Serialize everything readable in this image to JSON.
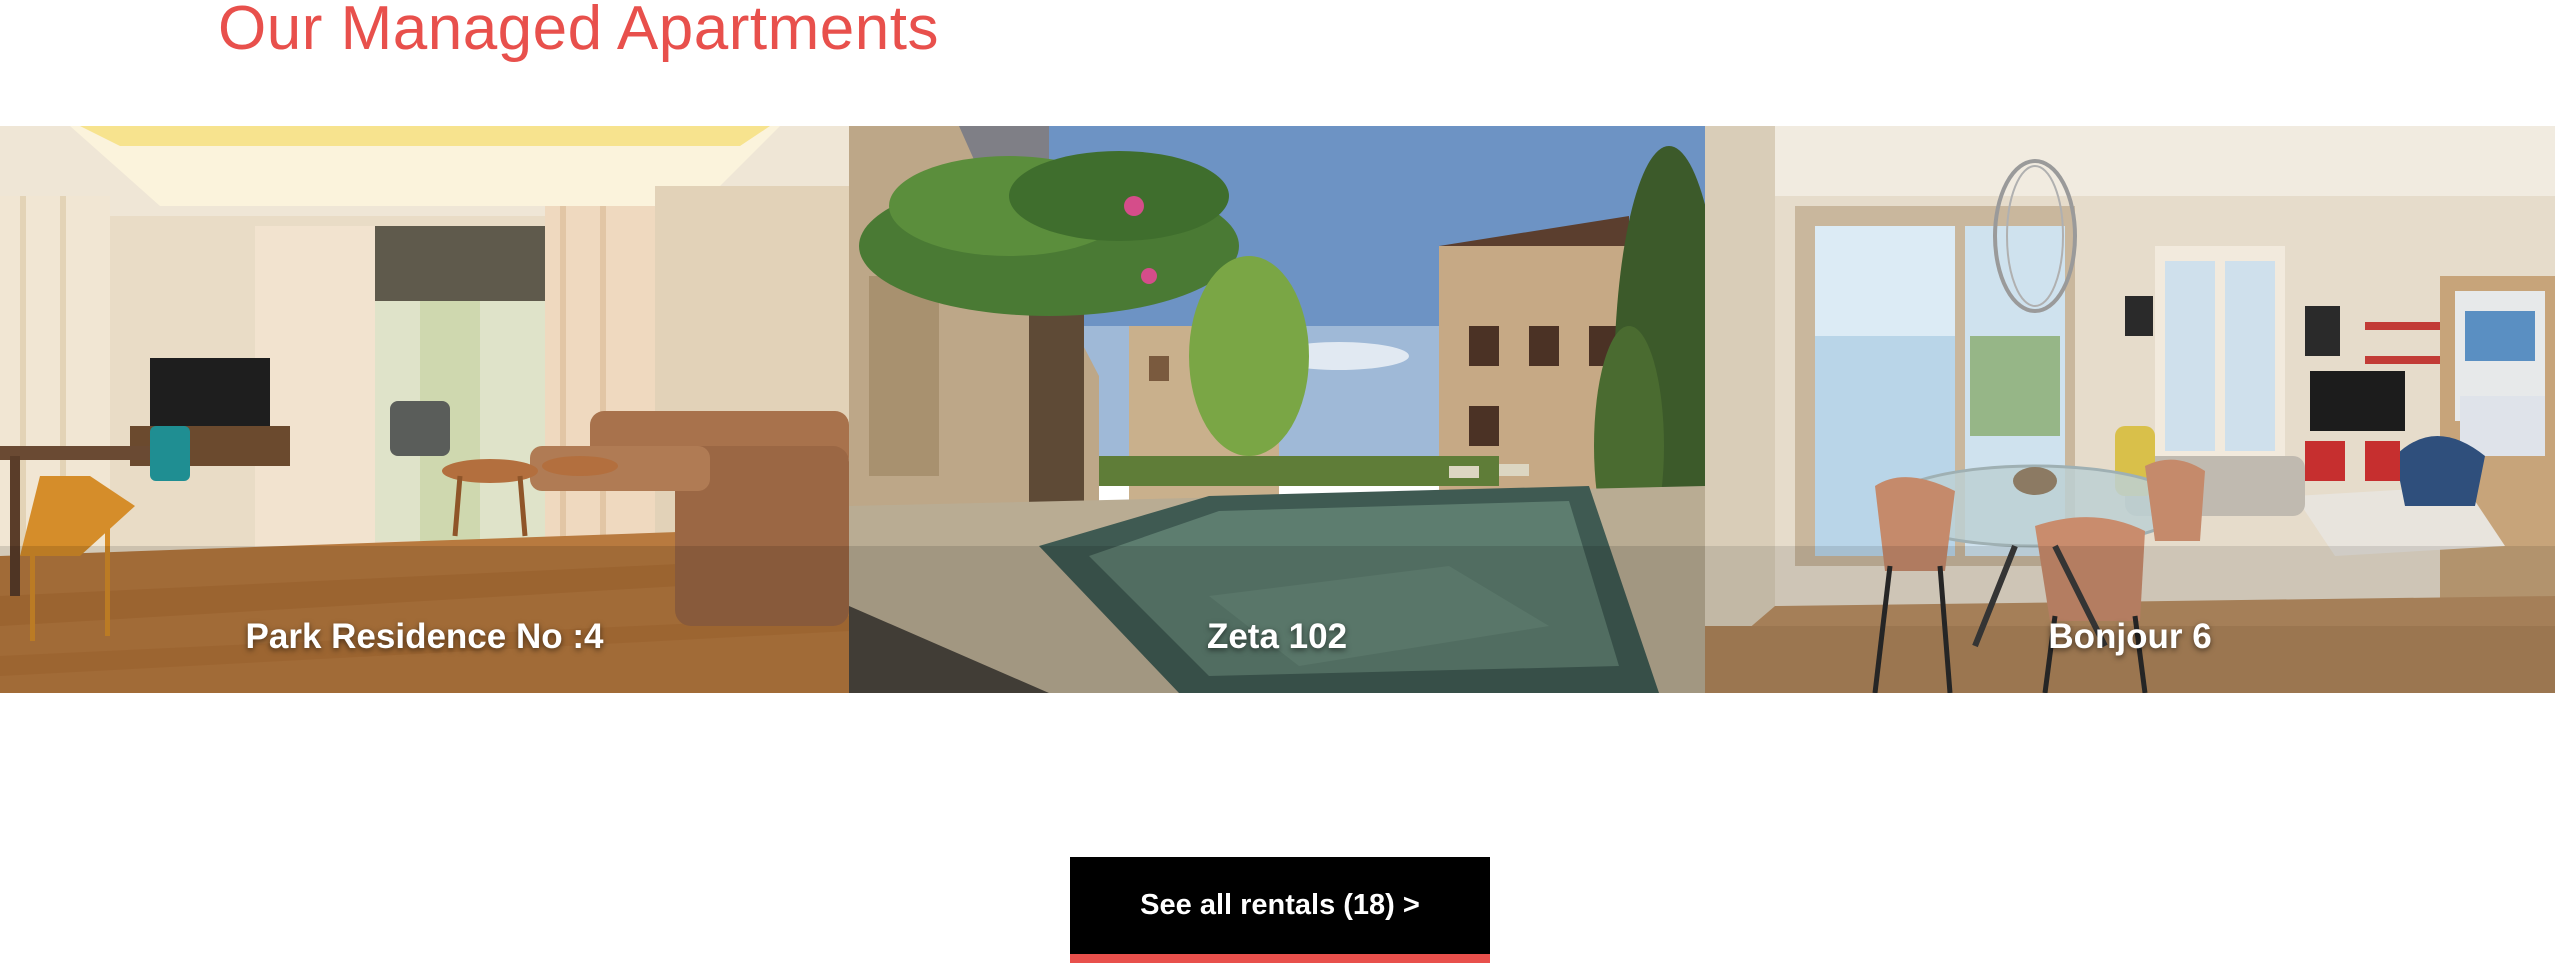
{
  "section": {
    "title": "Our Managed Apartments"
  },
  "listings": [
    {
      "name": "Park Residence No :4",
      "image": "living-room-photo"
    },
    {
      "name": "Zeta 102",
      "image": "pool-courtyard-photo"
    },
    {
      "name": "Bonjour 6",
      "image": "dining-living-photo"
    }
  ],
  "cta": {
    "label": "See all rentals (18) >"
  },
  "colors": {
    "accent": "#e8504c",
    "button_bg": "#000000",
    "label_text": "#ffffff"
  }
}
